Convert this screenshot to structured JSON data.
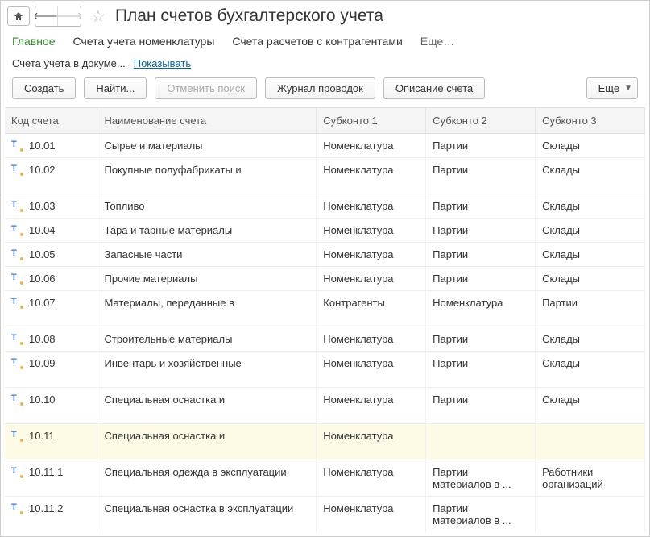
{
  "title": "План счетов бухгалтерского учета",
  "tabs": {
    "main": "Главное",
    "nomen": "Счета учета номенклатуры",
    "contr": "Счета расчетов с контрагентами",
    "more": "Еще…"
  },
  "subline": {
    "label": "Счета учета в докуме...",
    "link": "Показывать"
  },
  "toolbar": {
    "create": "Создать",
    "find": "Найти...",
    "cancel_search": "Отменить поиск",
    "journal": "Журнал проводок",
    "desc": "Описание счета",
    "more": "Еще"
  },
  "columns": {
    "code": "Код счета",
    "name": "Наименование счета",
    "s1": "Субконто 1",
    "s2": "Субконто 2",
    "s3": "Субконто 3"
  },
  "rows": [
    {
      "code": "10.01",
      "name": "Сырье и материалы",
      "s1": "Номенклатура",
      "s2": "Партии",
      "s3": "Склады"
    },
    {
      "code": "10.02",
      "name": "Покупные полуфабрикаты и",
      "s1": "Номенклатура",
      "s2": "Партии",
      "s3": "Склады",
      "tall": true
    },
    {
      "code": "10.03",
      "name": "Топливо",
      "s1": "Номенклатура",
      "s2": "Партии",
      "s3": "Склады"
    },
    {
      "code": "10.04",
      "name": "Тара и тарные материалы",
      "s1": "Номенклатура",
      "s2": "Партии",
      "s3": "Склады"
    },
    {
      "code": "10.05",
      "name": "Запасные части",
      "s1": "Номенклатура",
      "s2": "Партии",
      "s3": "Склады"
    },
    {
      "code": "10.06",
      "name": "Прочие материалы",
      "s1": "Номенклатура",
      "s2": "Партии",
      "s3": "Склады"
    },
    {
      "code": "10.07",
      "name": "Материалы, переданные в",
      "s1": "Контрагенты",
      "s2": "Номенклатура",
      "s3": "Партии",
      "tall": true
    },
    {
      "code": "10.08",
      "name": "Строительные материалы",
      "s1": "Номенклатура",
      "s2": "Партии",
      "s3": "Склады"
    },
    {
      "code": "10.09",
      "name": "Инвентарь и хозяйственные",
      "s1": "Номенклатура",
      "s2": "Партии",
      "s3": "Склады",
      "tall": true
    },
    {
      "code": "10.10",
      "name": "Специальная оснастка и",
      "s1": "Номенклатура",
      "s2": "Партии",
      "s3": "Склады",
      "tall": true
    },
    {
      "code": "10.11",
      "name": "Специальная оснастка и",
      "s1": "Номенклатура",
      "s2": "",
      "s3": "",
      "tall": true,
      "sel": true
    },
    {
      "code": "10.11.1",
      "name": "Специальная одежда в эксплуатации",
      "s1": "Номенклатура",
      "s2": "Партии материалов в ...",
      "s3": "Работники организаций"
    },
    {
      "code": "10.11.2",
      "name": "Специальная оснастка в эксплуатации",
      "s1": "Номенклатура",
      "s2": "Партии материалов в ...",
      "s3": ""
    }
  ]
}
